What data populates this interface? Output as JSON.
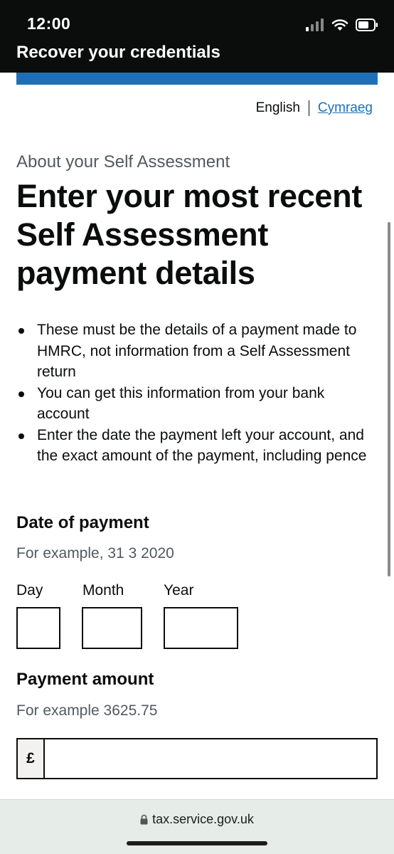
{
  "status_bar": {
    "time": "12:00"
  },
  "header": {
    "title": "Recover your credentials"
  },
  "language": {
    "current": "English",
    "other": "Cymraeg"
  },
  "page": {
    "caption": "About your Self Assessment",
    "heading": "Enter your most recent Self Assessment payment details",
    "bullets": [
      "These must be the details of a payment made to HMRC, not information from a Self Assessment return",
      "You can get this information from your bank account",
      "Enter the date the payment left your account, and the exact amount of the payment, including pence"
    ]
  },
  "date_of_payment": {
    "label": "Date of payment",
    "hint": "For example, 31 3 2020",
    "day_label": "Day",
    "month_label": "Month",
    "year_label": "Year",
    "day_value": "",
    "month_value": "",
    "year_value": ""
  },
  "payment_amount": {
    "label": "Payment amount",
    "hint": "For example 3625.75",
    "prefix": "£",
    "value": ""
  },
  "browser": {
    "url": "tax.service.gov.uk"
  },
  "colors": {
    "brand_blue": "#1d70b8",
    "header_black": "#0b0c0c",
    "hint_grey": "#505a5f"
  }
}
